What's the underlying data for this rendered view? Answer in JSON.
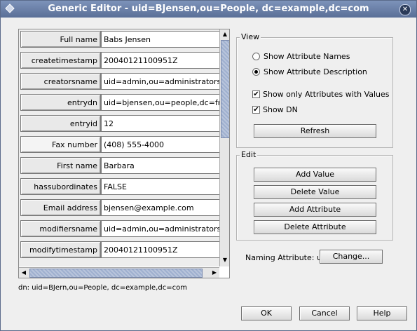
{
  "window": {
    "title": "Generic Editor - uid=BJensen,ou=People, dc=example,dc=com"
  },
  "attributes": [
    {
      "name": "Full name",
      "value": "Babs Jensen"
    },
    {
      "name": "createtimestamp",
      "value": "20040121100951Z"
    },
    {
      "name": "creatorsname",
      "value": "uid=admin,ou=administrators,ou=to"
    },
    {
      "name": "entrydn",
      "value": "uid=bjensen,ou=people,dc=france"
    },
    {
      "name": "entryid",
      "value": "12"
    },
    {
      "name": "Fax number",
      "value": "(408) 555-4000"
    },
    {
      "name": "First name",
      "value": "Barbara"
    },
    {
      "name": "hassubordinates",
      "value": "FALSE"
    },
    {
      "name": "Email address",
      "value": "bjensen@example.com"
    },
    {
      "name": "modifiersname",
      "value": "uid=admin,ou=administrators,ou=to"
    },
    {
      "name": "modifytimestamp",
      "value": "20040121100951Z"
    }
  ],
  "dn_line": "dn: uid=BJern,ou=People, dc=example,dc=com",
  "view": {
    "title": "View",
    "show_names": {
      "label": "Show Attribute Names",
      "selected": false
    },
    "show_description": {
      "label": "Show Attribute Description",
      "selected": true
    },
    "only_with_values": {
      "label": "Show only Attributes with Values",
      "checked": true
    },
    "show_dn": {
      "label": "Show DN",
      "checked": true
    },
    "refresh_label": "Refresh"
  },
  "edit": {
    "title": "Edit",
    "add_value": "Add Value",
    "delete_value": "Delete Value",
    "add_attribute": "Add Attribute",
    "delete_attribute": "Delete Attribute"
  },
  "naming": {
    "label": "Naming Attribute: uid",
    "change_label": "Change..."
  },
  "footer": {
    "ok": "OK",
    "cancel": "Cancel",
    "help": "Help"
  },
  "icons": {
    "close": "close-icon",
    "window_menu": "window-menu-icon"
  }
}
